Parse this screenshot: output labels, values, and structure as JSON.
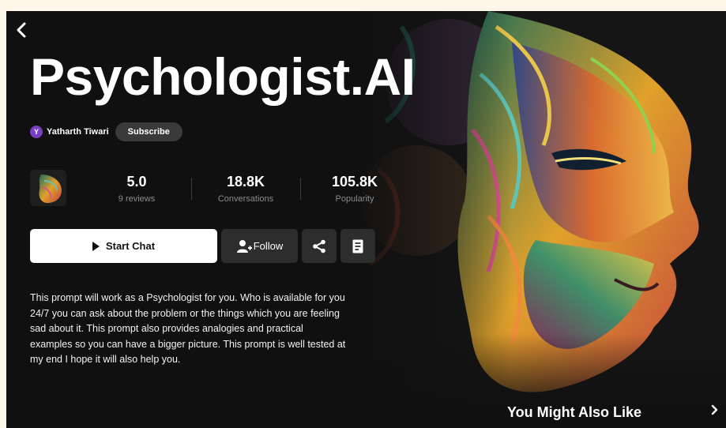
{
  "nav": {
    "back_icon": "chevron-left-icon",
    "next_icon": "chevron-right-icon"
  },
  "header": {
    "title": "Psychologist.AI",
    "author_initial": "Y",
    "author_name": "Yatharth Tiwari",
    "subscribe_label": "Subscribe"
  },
  "stats": [
    {
      "value": "5.0",
      "label": "9 reviews"
    },
    {
      "value": "18.8K",
      "label": "Conversations"
    },
    {
      "value": "105.8K",
      "label": "Popularity"
    }
  ],
  "actions": {
    "start_chat_label": "Start Chat",
    "follow_label": "Follow",
    "share_icon": "share-icon",
    "notes_icon": "document-icon"
  },
  "description": "This prompt will work as a Psychologist for you. Who is available for you 24/7 you can ask about the problem or the things which you are feeling sad about it. This prompt also provides analogies and practical examples so you can have a bigger picture. This prompt is well tested at my end I hope it will also help you.",
  "section": {
    "also_like": "You Might Also Like"
  },
  "colors": {
    "background": "#101010",
    "accent_avatar": "#7b3fc6",
    "button_primary": "#ffffff",
    "button_secondary": "#2d2d2d"
  }
}
